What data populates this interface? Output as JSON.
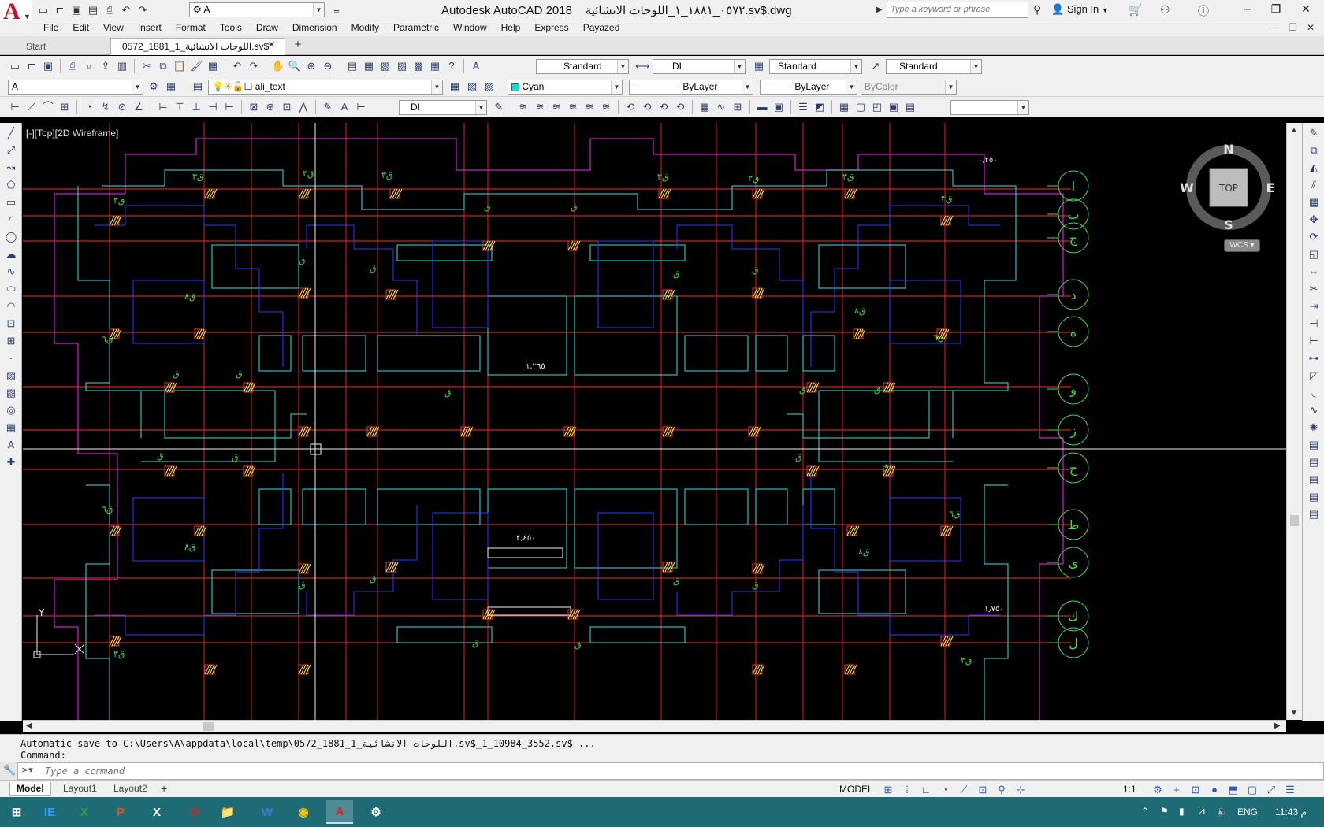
{
  "window": {
    "app_name": "Autodesk AutoCAD 2018",
    "file_title": "٠٥٧٢_١٨٨١_١_اللوحات الانشائية.sv$.dwg",
    "search_placeholder": "Type a keyword or phrase",
    "sign_in": "Sign In",
    "workspace_value": "A",
    "colors": {
      "logo_red": "#c8102e",
      "taskbar": "#1e6b76",
      "canvas": "#000000"
    }
  },
  "menu": [
    "File",
    "Edit",
    "View",
    "Insert",
    "Format",
    "Tools",
    "Draw",
    "Dimension",
    "Modify",
    "Parametric",
    "Window",
    "Help",
    "Express",
    "Payazed"
  ],
  "tabs": {
    "start": "Start",
    "active": "0572_1881_1_اللوحات الانشائية.sv$*"
  },
  "toolbars": {
    "text_style": "Standard",
    "dim_style": "DI",
    "table_style": "Standard",
    "multileader_style": "Standard",
    "layer_state": "A",
    "layer_name": "ali_text",
    "color": "Cyan",
    "linetype": "ByLayer",
    "lineweight": "ByLayer",
    "plot_style": "ByColor",
    "dim_style_2": "DI"
  },
  "viewport": {
    "label": "[-][Top][2D Wireframe]",
    "viewcube": {
      "north": "N",
      "south": "S",
      "east": "E",
      "west": "W",
      "face": "TOP",
      "ucs": "WCS"
    },
    "ucs_icon": {
      "y": "Y",
      "x": "X"
    }
  },
  "grid_bubbles": [
    "ا",
    "ب",
    "ج",
    "د",
    "ه",
    "و",
    "ز",
    "ح",
    "ط",
    "ى",
    "ك",
    "ل"
  ],
  "drawing_labels": {
    "dim_1": "١,٢٦٥",
    "dim_2": "٢,٤٥٠",
    "dim_3": "٠,٢٥٠",
    "dim_4": "١٫٧٥٠",
    "tag_q": "ق",
    "tag_q3": "ق٣",
    "tag_q6": "ق٦",
    "tag_q8": "ق٨"
  },
  "command": {
    "history_1": "Automatic save to C:\\Users\\A\\appdata\\local\\temp\\0572_1881_1_اللوحات الانشائية.sv$_1_10984_3552.sv$ ...",
    "history_2": "Command:",
    "placeholder": "Type a command"
  },
  "status": {
    "layouts": [
      "Model",
      "Layout1",
      "Layout2"
    ],
    "space": "MODEL",
    "scale": "1:1"
  },
  "taskbar": {
    "apps": [
      "IE",
      "X",
      "P",
      "X",
      "O",
      "📁",
      "W",
      "◉",
      "A",
      "⚙"
    ],
    "lang": "ENG",
    "clock": "11:43 م"
  }
}
